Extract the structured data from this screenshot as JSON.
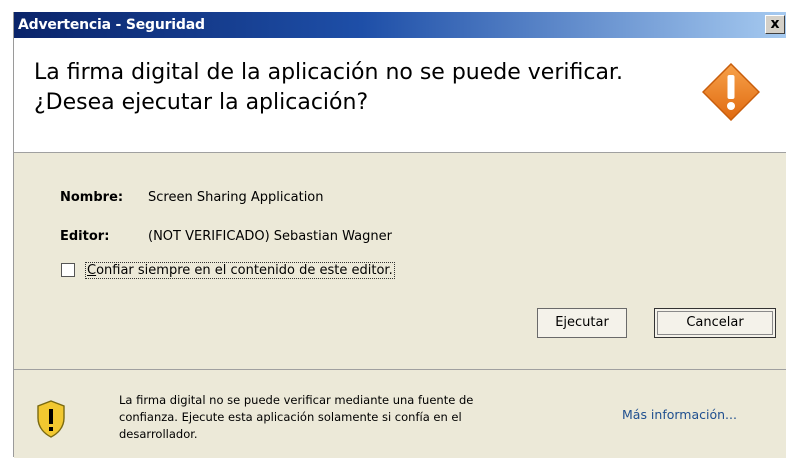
{
  "window": {
    "title": "Advertencia - Seguridad",
    "close_label": "x"
  },
  "header": {
    "line1": "La firma digital de la aplicación no se puede verificar.",
    "line2": "¿Desea ejecutar la aplicación?",
    "icon": "warning-diamond-icon",
    "icon_color": "#f08a24"
  },
  "details": {
    "name_label": "Nombre:",
    "name_value": "Screen Sharing Application",
    "publisher_label": "Editor:",
    "publisher_value": "(NOT VERIFICADO) Sebastian Wagner"
  },
  "checkbox": {
    "label_accel": "C",
    "label_rest": "onfiar siempre en el contenido de este editor.",
    "checked": false
  },
  "buttons": {
    "run": "Ejecutar",
    "cancel": "Cancelar"
  },
  "footer": {
    "icon": "shield-warning-icon",
    "line1": "La firma digital no se puede verificar mediante una fuente de",
    "line2": "confianza.  Ejecute esta aplicación solamente si confía en el",
    "line3": "desarrollador.",
    "more_info": "Más información..."
  }
}
